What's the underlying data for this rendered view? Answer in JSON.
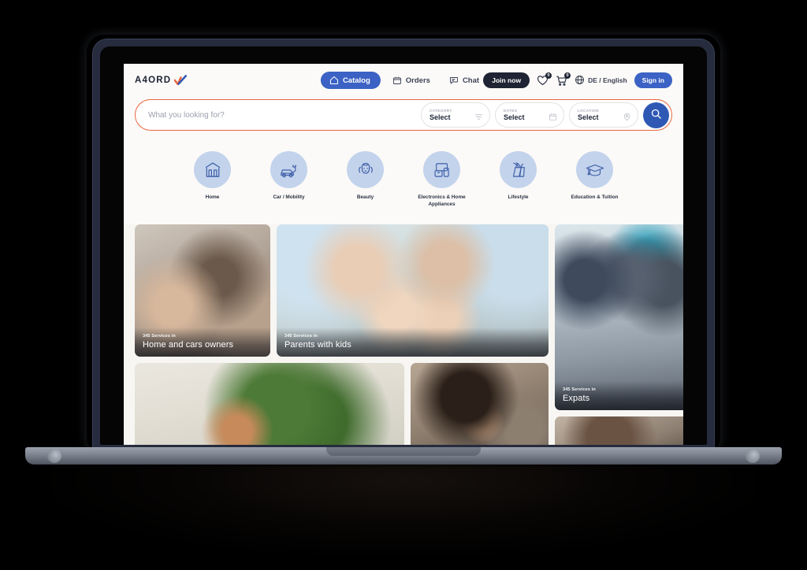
{
  "brand": {
    "logo_text": "A4ORD",
    "logo_icon": "check-mark-icon",
    "accent_orange": "#e8653c",
    "accent_blue": "#3b62c4",
    "dark": "#1e2433",
    "page_bg": "#f7f6f3"
  },
  "header": {
    "nav": [
      {
        "label": "Catalog",
        "icon": "home-icon",
        "active": true
      },
      {
        "label": "Orders",
        "icon": "orders-box-icon",
        "active": false
      },
      {
        "label": "Chat",
        "icon": "chat-bubble-icon",
        "active": false
      }
    ],
    "join_label": "Join now",
    "signin_label": "Sign in",
    "wishlist": {
      "icon": "heart-icon",
      "count": "0"
    },
    "cart": {
      "icon": "cart-icon",
      "count": "0"
    },
    "language": {
      "icon": "globe-icon",
      "label": "DE / English"
    }
  },
  "search": {
    "placeholder": "What you looking for?",
    "value": "",
    "go_icon": "search-icon",
    "filters": [
      {
        "label": "CATEGORY",
        "value": "Select",
        "icon": "filter-lines-icon"
      },
      {
        "label": "DATES",
        "value": "Select",
        "icon": "calendar-icon"
      },
      {
        "label": "LOCATION",
        "value": "Select",
        "icon": "map-pin-icon"
      }
    ]
  },
  "categories": [
    {
      "label": "Home",
      "icon": "house-icon"
    },
    {
      "label": "Car / Mobility",
      "icon": "electric-car-icon"
    },
    {
      "label": "Beauty",
      "icon": "beauty-face-icon"
    },
    {
      "label": "Electronics &\nHome Appliances",
      "icon": "devices-icon"
    },
    {
      "label": "Lifestyle",
      "icon": "shopping-bags-icon"
    },
    {
      "label": "Education &\nTuition",
      "icon": "graduation-cap-icon"
    }
  ],
  "cards": [
    {
      "kicker": "345 Services in",
      "title": "Home and cars owners"
    },
    {
      "kicker": "345 Services in",
      "title": "Parents with kids"
    },
    {
      "kicker": "345 Services in",
      "title": "Expats"
    }
  ]
}
